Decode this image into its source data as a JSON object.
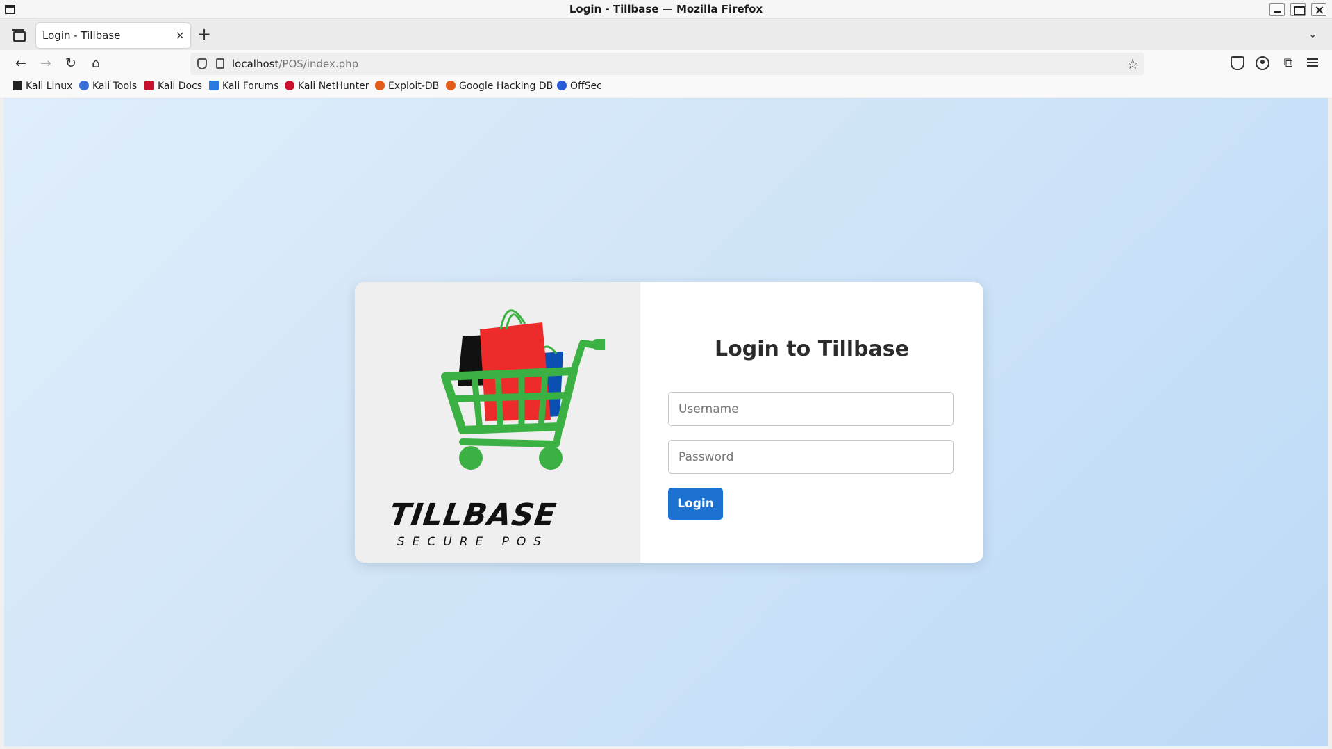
{
  "window": {
    "title": "Login - Tillbase — Mozilla Firefox"
  },
  "tabs": [
    {
      "label": "Login - Tillbase",
      "close": "×"
    }
  ],
  "toolbar": {
    "new_tab": "+",
    "back": "←",
    "forward": "→",
    "reload": "↻",
    "home": "⌂",
    "star": "☆",
    "extensions": "⧉",
    "tab_overflow": "⌄"
  },
  "url": {
    "host": "localhost",
    "path": "/POS/index.php"
  },
  "bookmarks": [
    {
      "label": "Kali Linux",
      "icon": "kali-dragon-icon",
      "color": "#222222"
    },
    {
      "label": "Kali Tools",
      "icon": "kali-tools-icon",
      "color": "#3a6fd8"
    },
    {
      "label": "Kali Docs",
      "icon": "kali-docs-icon",
      "color": "#c8102e"
    },
    {
      "label": "Kali Forums",
      "icon": "kali-forums-icon",
      "color": "#2a7ae2"
    },
    {
      "label": "Kali NetHunter",
      "icon": "kali-nethunter-icon",
      "color": "#c8102e"
    },
    {
      "label": "Exploit-DB",
      "icon": "exploit-db-icon",
      "color": "#e25c1c"
    },
    {
      "label": "Google Hacking DB",
      "icon": "ghdb-icon",
      "color": "#e25c1c"
    },
    {
      "label": "OffSec",
      "icon": "offsec-icon",
      "color": "#2a5bd8"
    }
  ],
  "login": {
    "title": "Login to Tillbase",
    "username_placeholder": "Username",
    "password_placeholder": "Password",
    "button": "Login"
  },
  "logo": {
    "name": "TILLBASE",
    "tagline": "SECURE POS"
  },
  "colors": {
    "accent": "#1d72d1",
    "cart": "#3bb143",
    "bag_red": "#ee2b2b",
    "bag_blue": "#0b4fb3"
  }
}
